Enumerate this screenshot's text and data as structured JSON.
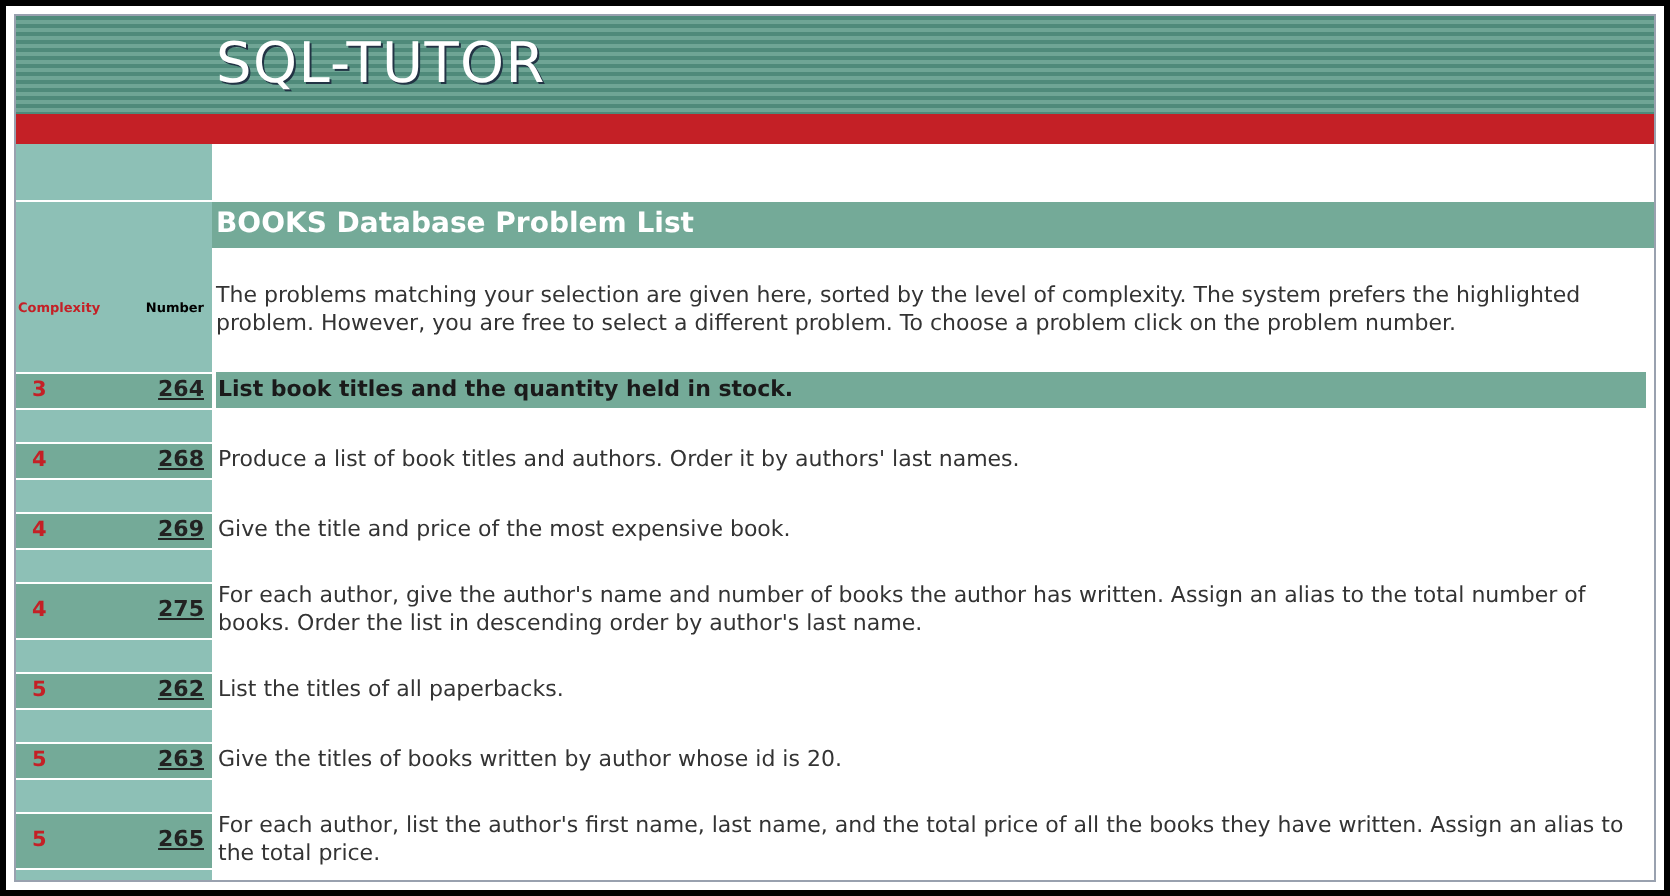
{
  "header": {
    "logo": "SQL-TUTOR"
  },
  "page_title": "BOOKS Database Problem List",
  "columns": {
    "complexity": "Complexity",
    "number": "Number"
  },
  "intro": "The problems matching your selection are given here, sorted by the level of complexity. The system prefers the highlighted problem. However, you are free to select a different problem. To choose a problem click on the problem number.",
  "problems": [
    {
      "complexity": "3",
      "number": "264",
      "text": "List book titles and the quantity held in stock.",
      "selected": true
    },
    {
      "complexity": "4",
      "number": "268",
      "text": "Produce a list of book titles and authors. Order it by authors' last names.",
      "selected": false
    },
    {
      "complexity": "4",
      "number": "269",
      "text": "Give the title and price of the most expensive book.",
      "selected": false
    },
    {
      "complexity": "4",
      "number": "275",
      "text": "For each author, give the author's name and number of books the author has written. Assign an alias to the total number of books. Order the list in descending order by author's last name.",
      "selected": false
    },
    {
      "complexity": "5",
      "number": "262",
      "text": "List the titles of all paperbacks.",
      "selected": false
    },
    {
      "complexity": "5",
      "number": "263",
      "text": "Give the titles of books written by author whose id is 20.",
      "selected": false
    },
    {
      "complexity": "5",
      "number": "265",
      "text": "For each author, list the author's first name, last name, and the total price of all the books they have written. Assign an alias to the total price.",
      "selected": false
    }
  ]
}
